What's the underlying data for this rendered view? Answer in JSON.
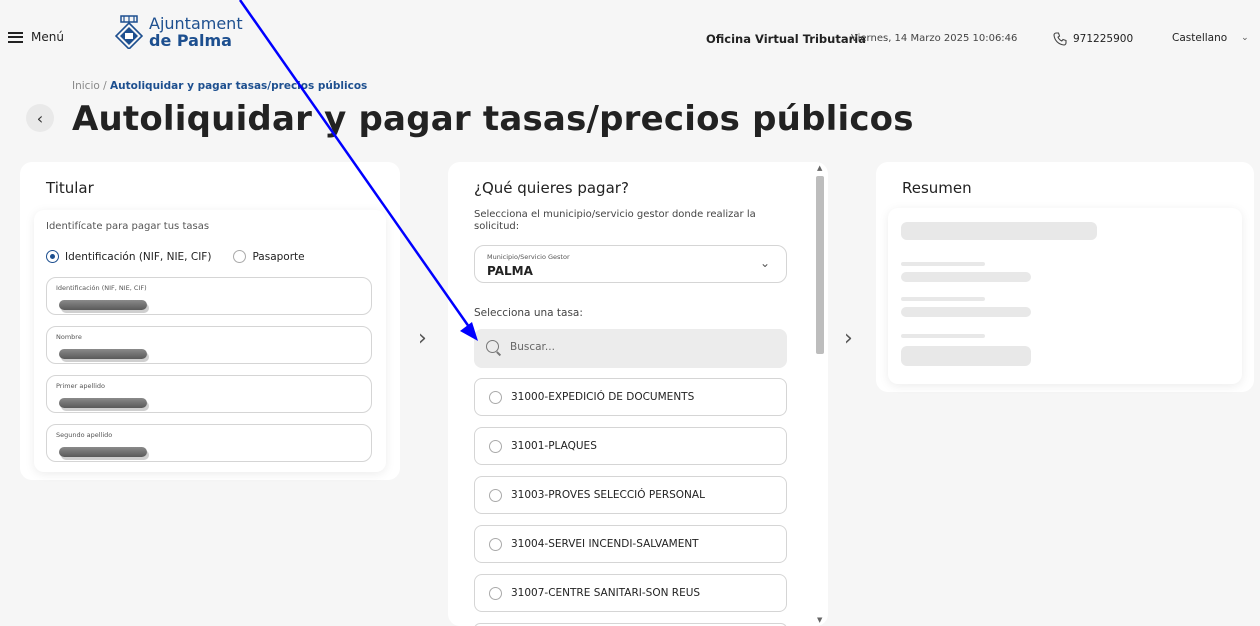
{
  "header": {
    "menu_label": "Menú",
    "logo_line1": "Ajuntament",
    "logo_line2": "de Palma",
    "office": "Oficina Virtual Tributaria",
    "datetime": "Viernes, 14 Marzo 2025 10:06:46",
    "phone": "971225900",
    "language": "Castellano"
  },
  "breadcrumb": {
    "home": "Inicio",
    "separator": " / ",
    "current": "Autoliquidar y pagar tasas/precios públicos"
  },
  "page_title": "Autoliquidar y pagar tasas/precios públicos",
  "titular": {
    "title": "Titular",
    "hint": "Identifícate para pagar tus tasas",
    "options": [
      {
        "label": "Identificación (NIF, NIE, CIF)",
        "selected": true
      },
      {
        "label": "Pasaporte",
        "selected": false
      }
    ],
    "fields": [
      {
        "label": "Identificación (NIF, NIE, CIF)"
      },
      {
        "label": "Nombre"
      },
      {
        "label": "Primer apellido"
      },
      {
        "label": "Segundo apellido"
      }
    ]
  },
  "payment": {
    "title": "¿Qué quieres pagar?",
    "description": "Selecciona el municipio/servicio gestor donde realizar la solicitud:",
    "municipio_label": "Municipio/Servicio Gestor",
    "municipio_value": "PALMA",
    "tasa_label": "Selecciona una tasa:",
    "search_placeholder": "Buscar...",
    "tasas": [
      "31000-EXPEDICIÓ DE DOCUMENTS",
      "31001-PLAQUES",
      "31003-PROVES SELECCIÓ PERSONAL",
      "31004-SERVEI INCENDI-SALVAMENT",
      "31007-CENTRE SANITARI-SON REUS"
    ]
  },
  "summary": {
    "title": "Resumen"
  },
  "colors": {
    "brand": "#1d4f8f",
    "annotation_arrow": "#0000ff"
  },
  "icons": [
    "menu-icon",
    "city-crest-icon",
    "phone-icon",
    "chevron-down-icon",
    "back-chevron-icon",
    "chevron-right-icon",
    "search-icon",
    "scroll-up-icon",
    "scroll-down-icon"
  ]
}
